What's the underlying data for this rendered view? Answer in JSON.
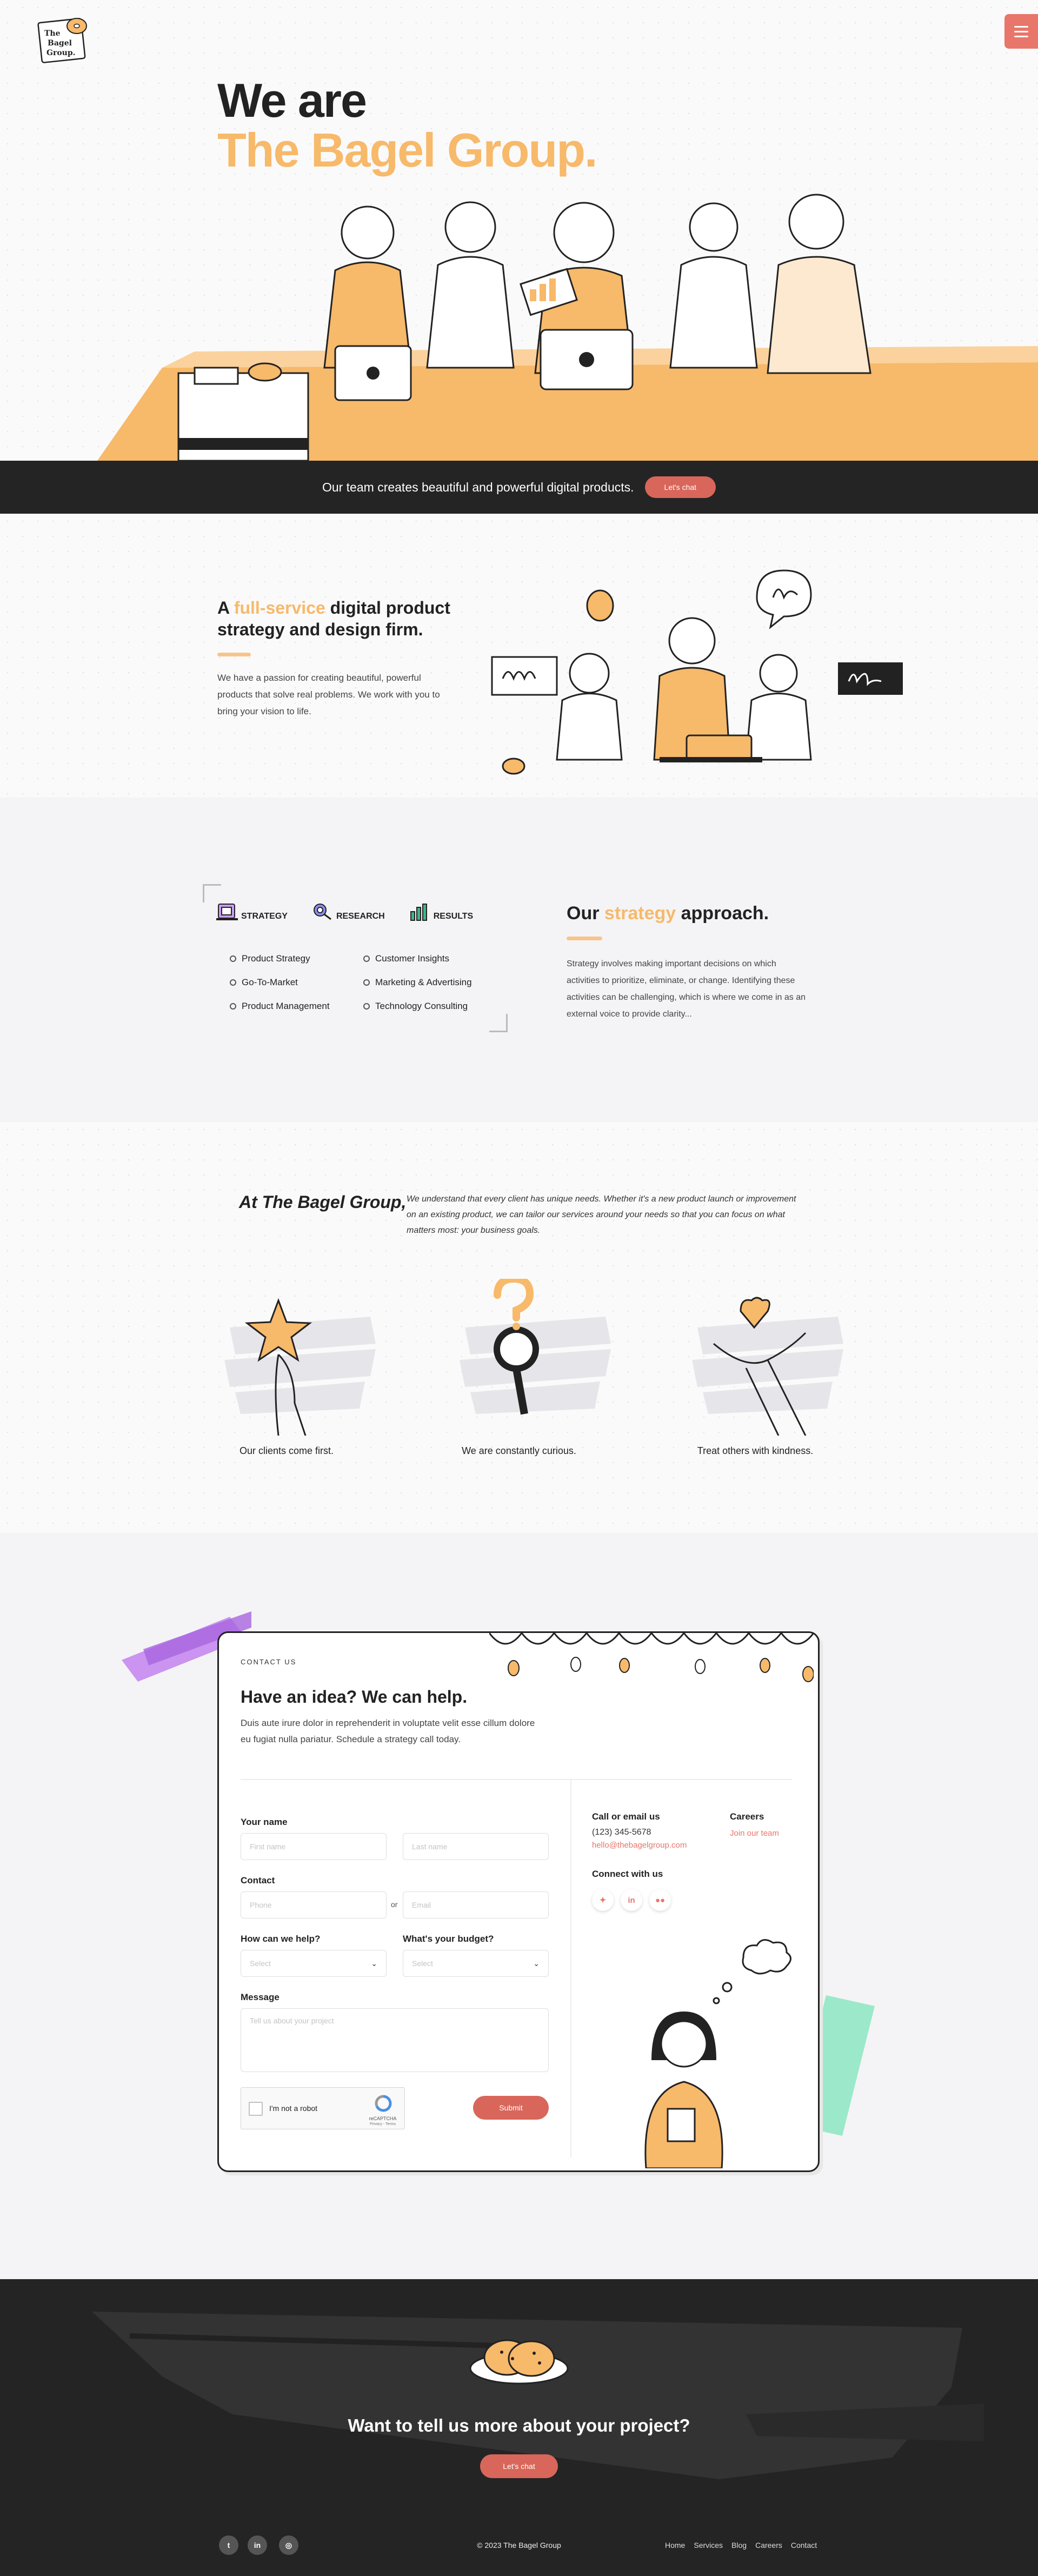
{
  "colors": {
    "accent": "#f7b96a",
    "coral": "#e8766a",
    "dark": "#242424"
  },
  "logo": {
    "icon": "bagel-logo-icon",
    "text": [
      "The",
      "Bagel",
      "Group."
    ]
  },
  "hero": {
    "line1": "We are",
    "line2": "The Bagel Group.",
    "banner_text": "Our team creates beautiful and powerful digital products.",
    "banner_button": "Let's chat"
  },
  "intro": {
    "heading_pre": "A ",
    "heading_accent": "full-service",
    "heading_post": " digital product strategy and design firm.",
    "body": "We have a passion for creating beautiful, powerful products that solve real problems. We work with you to bring your vision to life."
  },
  "approach": {
    "tabs": [
      {
        "label": "STRATEGY",
        "icon": "strategy-icon"
      },
      {
        "label": "RESEARCH",
        "icon": "research-icon"
      },
      {
        "label": "RESULTS",
        "icon": "results-icon"
      }
    ],
    "services_left": [
      "Product Strategy",
      "Go-To-Market",
      "Product Management"
    ],
    "services_right": [
      "Customer Insights",
      "Marketing & Advertising",
      "Technology Consulting"
    ],
    "heading_pre": "Our ",
    "heading_accent": "strategy",
    "heading_post": " approach.",
    "body": "Strategy involves making important decisions on which activities to prioritize, eliminate, or change. Identifying these activities can be challenging, which is where we come in as an external voice to provide clarity..."
  },
  "values": {
    "title": "At The Bagel Group,",
    "quote": "We understand that every client has unique needs. Whether it's a new product launch or improvement on an existing product, we can tailor our services around your needs so that you can focus on what matters most: your business goals.",
    "items": [
      {
        "label": "Our clients come first.",
        "icon": "hand-star-icon"
      },
      {
        "label": "We are constantly curious.",
        "icon": "magnifier-question-icon"
      },
      {
        "label": "Treat others with kindness.",
        "icon": "hand-heart-icon"
      }
    ]
  },
  "contact": {
    "eyebrow": "CONTACT US",
    "heading": "Have an idea? We can help.",
    "body": "Duis aute irure dolor in reprehenderit in voluptate velit esse cillum dolore eu fugiat nulla pariatur. Schedule a strategy call today.",
    "name_label": "Your name",
    "first_placeholder": "First name",
    "last_placeholder": "Last name",
    "contact_label": "Contact",
    "phone_placeholder": "Phone",
    "or": "or",
    "email_placeholder": "Email",
    "help_label": "How can we help?",
    "help_value": "Select",
    "budget_label": "What's your budget?",
    "budget_value": "Select",
    "message_label": "Message",
    "message_placeholder": "Tell us about your project",
    "captcha_text": "I'm not a robot",
    "captcha_brand": "reCAPTCHA",
    "captcha_sub": "Privacy - Terms",
    "submit": "Submit",
    "call_label": "Call or email us",
    "phone": "(123) 345-5678",
    "email": "hello@thebagelgroup.com",
    "careers_label": "Careers",
    "careers_link": "Join our team",
    "connect_label": "Connect with us",
    "socials": [
      {
        "icon": "twitter-icon",
        "glyph": "🐦",
        "color": "#e8766a"
      },
      {
        "icon": "linkedin-icon",
        "glyph": "in",
        "color": "#e8766a"
      },
      {
        "icon": "flickr-icon",
        "glyph": "●●",
        "color": "#e8766a"
      }
    ]
  },
  "footer": {
    "title": "Want to tell us more about your project?",
    "button": "Let's chat",
    "socials": [
      {
        "icon": "twitter-icon",
        "glyph": "t"
      },
      {
        "icon": "linkedin-icon",
        "glyph": "in"
      },
      {
        "icon": "instagram-icon",
        "glyph": "◎"
      }
    ],
    "copyright": "© 2023 The Bagel Group",
    "nav": [
      "Home",
      "Services",
      "Blog",
      "Careers",
      "Contact"
    ]
  }
}
